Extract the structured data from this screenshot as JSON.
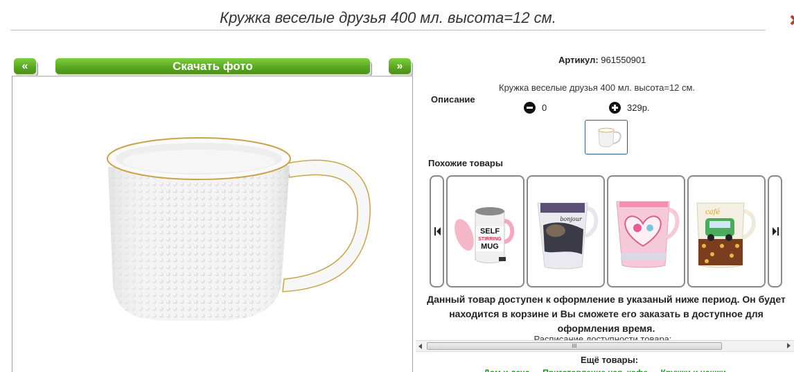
{
  "product": {
    "title": "Кружка веселые друзья 400 мл. высота=12 см.",
    "article_label": "Артикул:",
    "article_value": "961550901",
    "description_label": "Описание",
    "description_text": "Кружка веселые друзья 400 мл. высота=12 см.",
    "qty_value": "0",
    "price": "329р."
  },
  "gallery": {
    "prev_label": "«",
    "download_label": "Скачать фото",
    "next_label": "»"
  },
  "similar": {
    "title": "Похожие товары",
    "items": [
      {
        "name": "self-stirring-mug",
        "text_lines": [
          "SELF",
          "STIRRING",
          "MUG"
        ]
      },
      {
        "name": "bonjour-mug",
        "text_lines": [
          "bonjour"
        ]
      },
      {
        "name": "pink-heart-mug",
        "text_lines": []
      },
      {
        "name": "retro-car-mug",
        "text_lines": [
          "café"
        ]
      }
    ]
  },
  "availability": {
    "text": "Данный товар доступен к оформление в указаный ниже период. Он будет находится в корзине и Вы сможете его заказать в доступное для оформления время.",
    "schedule_text": "Расписание доступности товара:"
  },
  "scrollbar": {
    "grip": "III"
  },
  "more": {
    "title": "Ещё товары:",
    "links_text": "Дом и дача → Приготовление чая, кофе → Кружки и чашки"
  },
  "colors": {
    "accent_green": "#5ba823",
    "link_green": "#1c8d1c",
    "thumb_border": "#2d5b8a"
  }
}
